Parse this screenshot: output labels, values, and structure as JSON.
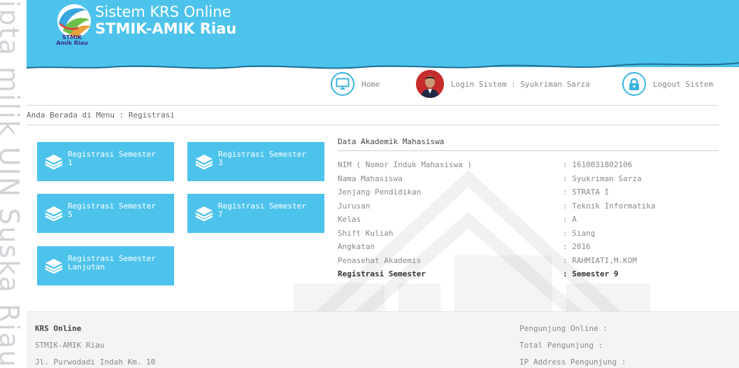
{
  "watermark": {
    "text": "ipta milik UIN Suska Riau"
  },
  "header": {
    "logo_caption": "STMIK\nAmik Riau",
    "title_line1": "Sistem KRS Online",
    "title_line2": "STMIK-AMIK Riau",
    "bg_color": "#4dc3ec"
  },
  "nav": {
    "home_label": "Home",
    "home_icon": "monitor-icon",
    "login_label": "Login Sistem : Syukriman Sarza",
    "logout_label": "Logout Sistem",
    "logout_icon": "lock-icon"
  },
  "breadcrumb": "Anda Berada di Menu : Registrasi",
  "menu": {
    "tiles": [
      {
        "label": "Registrasi Semester\n1"
      },
      {
        "label": "Registrasi Semester\n3"
      },
      {
        "label": "Registrasi Semester\n5"
      },
      {
        "label": "Registrasi Semester\n7"
      },
      {
        "label": "Registrasi Semester\nLanjutan"
      }
    ],
    "tile_icon": "books-stack-icon"
  },
  "academic": {
    "title": "Data Akademik Mahasiswa",
    "rows": [
      {
        "key": "NIM ( Nomor Induk Mahasiswa )",
        "value": ": 1610031802106"
      },
      {
        "key": "Nama Mahasiswa",
        "value": ": Syukriman Sarza"
      },
      {
        "key": "Jenjang Pendidikan",
        "value": ": STRATA I"
      },
      {
        "key": "Jurusan",
        "value": ": Teknik Informatika"
      },
      {
        "key": "Kelas",
        "value": ": A"
      },
      {
        "key": "Shift Kuliah",
        "value": ": Siang"
      },
      {
        "key": "Angkatan",
        "value": ": 2016"
      },
      {
        "key": "Penasehat Akademis",
        "value": ": RAHMIATI,M.KOM"
      },
      {
        "key": "Registrasi Semester",
        "value": ": Semester 9"
      }
    ]
  },
  "footer": {
    "left": [
      "KRS Online",
      "STMIK-AMIK Riau",
      "Jl. Purwodadi Indah Km. 10"
    ],
    "right": [
      "Pengunjung Online :",
      "Total Pengunjung :",
      "IP Address Pengunjung :"
    ]
  }
}
